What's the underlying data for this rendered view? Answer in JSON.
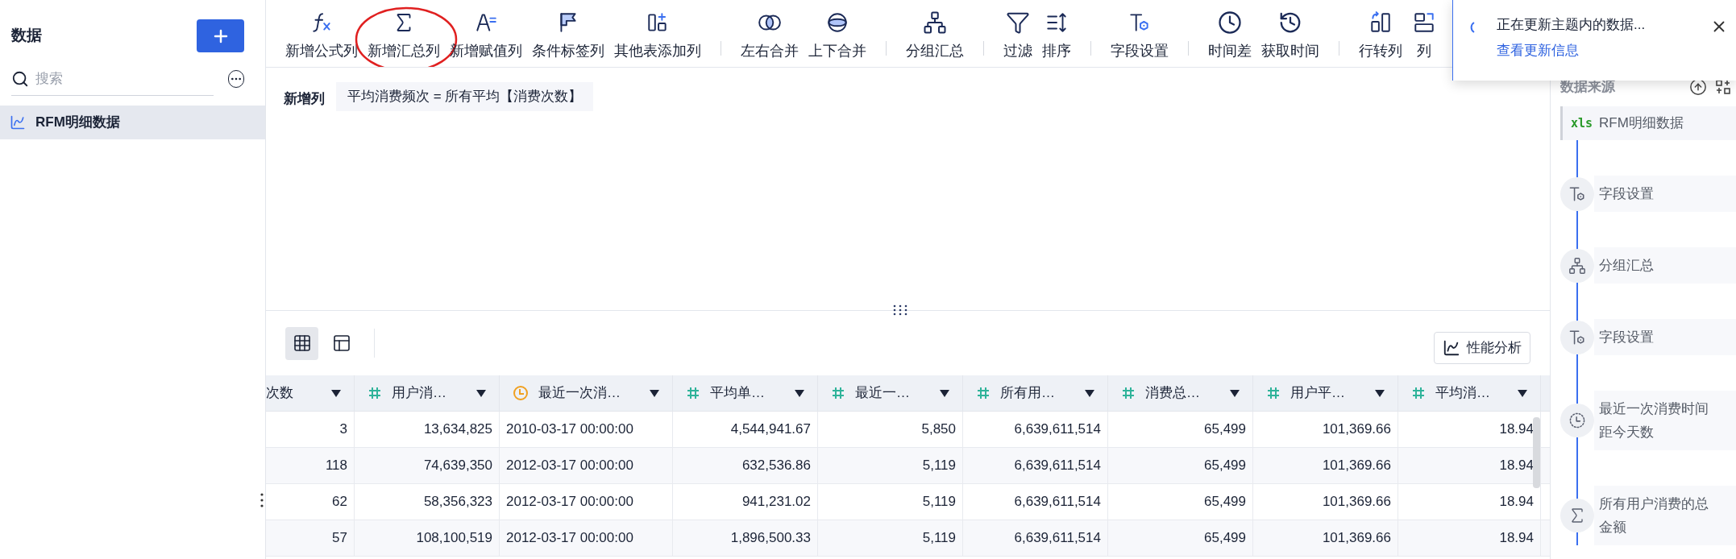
{
  "sidebar": {
    "title": "数据",
    "search": {
      "placeholder": "搜索"
    },
    "items": [
      {
        "label": "RFM明细数据",
        "selected": true
      }
    ]
  },
  "toolbar": [
    {
      "items": [
        {
          "kind": "formula",
          "label": "新增公式列",
          "circled": false
        },
        {
          "kind": "sum",
          "label": "新增汇总列",
          "circled": true
        },
        {
          "kind": "assign",
          "label": "新增赋值列",
          "circled": false
        },
        {
          "kind": "flag",
          "label": "条件标签列",
          "circled": false
        },
        {
          "kind": "addtable",
          "label": "其他表添加列",
          "circled": false
        }
      ]
    },
    {
      "items": [
        {
          "kind": "mergelr",
          "label": "左右合并",
          "circled": false
        },
        {
          "kind": "mergetb",
          "label": "上下合并",
          "circled": false
        }
      ]
    },
    {
      "items": [
        {
          "kind": "group",
          "label": "分组汇总",
          "circled": false
        }
      ]
    },
    {
      "items": [
        {
          "kind": "filter",
          "label": "过滤",
          "circled": false
        },
        {
          "kind": "sort",
          "label": "排序",
          "circled": false
        }
      ]
    },
    {
      "items": [
        {
          "kind": "field",
          "label": "字段设置",
          "circled": false
        }
      ]
    },
    {
      "items": [
        {
          "kind": "timediff",
          "label": "时间差",
          "circled": false
        },
        {
          "kind": "gettime",
          "label": "获取时间",
          "circled": false
        }
      ]
    },
    {
      "items": [
        {
          "kind": "rowcol",
          "label": "行转列",
          "circled": false
        },
        {
          "kind": "colrow",
          "label": "列",
          "circled": false
        }
      ]
    }
  ],
  "notification": {
    "message": "正在更新主题内的数据...",
    "link": "查看更新信息"
  },
  "formula": {
    "label": "新增列",
    "expression": "平均消费频次 = 所有平均【消费次数】"
  },
  "view_toggles": [
    {
      "kind": "grid",
      "selected": true
    },
    {
      "kind": "layout",
      "selected": false
    }
  ],
  "performance_button": "性能分析",
  "table": {
    "columns": [
      {
        "label": "次数"
      },
      {
        "kind": "number",
        "label": "用户消…"
      },
      {
        "kind": "time",
        "label": "最近一次消…"
      },
      {
        "kind": "number",
        "label": "平均单…"
      },
      {
        "kind": "number",
        "label": "最近一…"
      },
      {
        "kind": "number",
        "label": "所有用…"
      },
      {
        "kind": "number",
        "label": "消费总…"
      },
      {
        "kind": "number",
        "label": "用户平…"
      },
      {
        "kind": "number",
        "label": "平均消…"
      }
    ],
    "rows": [
      [
        "3",
        "13,634,825",
        "2010-03-17 00:00:00",
        "4,544,941.67",
        "5,850",
        "6,639,611,514",
        "65,499",
        "101,369.66",
        "18.94"
      ],
      [
        "118",
        "74,639,350",
        "2012-03-17 00:00:00",
        "632,536.86",
        "5,119",
        "6,639,611,514",
        "65,499",
        "101,369.66",
        "18.94"
      ],
      [
        "62",
        "58,356,323",
        "2012-03-17 00:00:00",
        "941,231.02",
        "5,119",
        "6,639,611,514",
        "65,499",
        "101,369.66",
        "18.94"
      ],
      [
        "57",
        "108,100,519",
        "2012-03-17 00:00:00",
        "1,896,500.33",
        "5,119",
        "6,639,611,514",
        "65,499",
        "101,369.66",
        "18.94"
      ]
    ]
  },
  "pipeline": {
    "title": "数据来源",
    "steps": [
      {
        "kind": "source",
        "badge": "xls",
        "label": "RFM明细数据"
      },
      {
        "kind": "field",
        "label": "字段设置"
      },
      {
        "kind": "group",
        "label": "分组汇总"
      },
      {
        "kind": "field",
        "label": "字段设置"
      },
      {
        "kind": "time",
        "label": "最近一次消费时间距今天数"
      },
      {
        "kind": "sum",
        "label": "所有用户消费的总金额"
      }
    ]
  }
}
